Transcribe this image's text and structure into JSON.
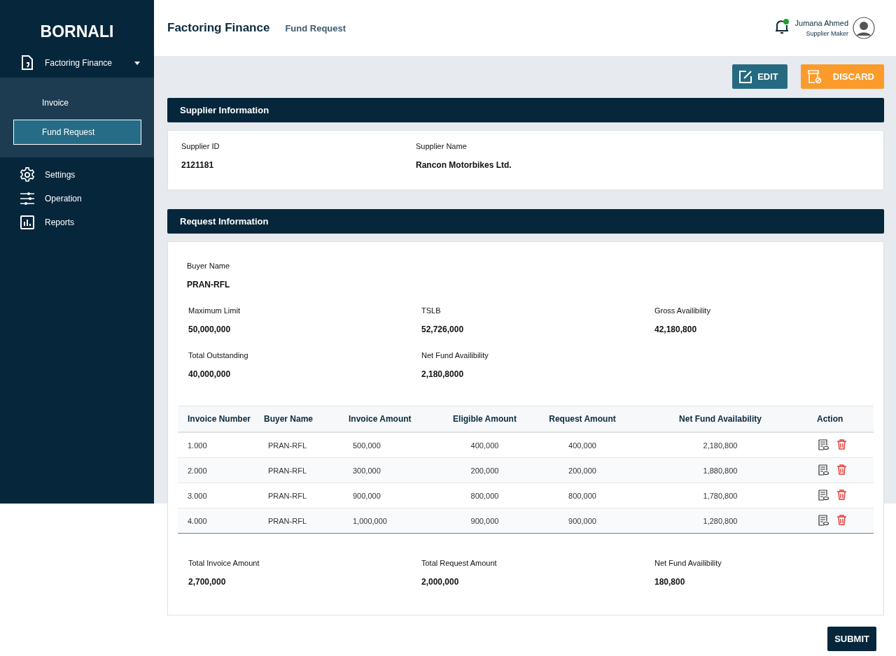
{
  "sidebar": {
    "brand": "BORNALI",
    "items": [
      {
        "label": "Factoring Finance",
        "expanded": true,
        "children": [
          {
            "label": "Invoice",
            "selected": false
          },
          {
            "label": "Fund Request",
            "selected": true
          }
        ]
      },
      {
        "label": "Settings"
      },
      {
        "label": "Operation"
      },
      {
        "label": "Reports"
      }
    ]
  },
  "header": {
    "title": "Factoring Finance",
    "subtitle": "Fund Request",
    "user": {
      "name": "Jumana Ahmed",
      "role": "Supplier Maker",
      "unread": true
    }
  },
  "actions": [
    {
      "label": "EDIT",
      "kind": "edit"
    },
    {
      "label": "DISCARD",
      "kind": "discard"
    }
  ],
  "supplier_information": {
    "title": "Supplier Information",
    "fields": [
      {
        "label": "Supplier ID",
        "value": "2121181"
      },
      {
        "label": "Supplier Name",
        "value": "Rancon Motorbikes Ltd."
      }
    ]
  },
  "request_information": {
    "title": "Request Information",
    "buyer": {
      "label": "Buyer Name",
      "value": "PRAN-RFL"
    },
    "fields": [
      {
        "label": "Maximum Limit",
        "value": "50,000,000"
      },
      {
        "label": "TSLB",
        "value": "52,726,000"
      },
      {
        "label": "Gross Availibility",
        "value": "42,180,800"
      },
      {
        "label": "Total Outstanding",
        "value": "40,000,000"
      },
      {
        "label": "Net Fund Availibility",
        "value": "2,180,8000"
      }
    ],
    "table": {
      "columns": [
        "Invoice Number",
        "Buyer Name",
        "Invoice Amount",
        "Eligible Amount",
        "Request Amount",
        "Net Fund Availability",
        "Action"
      ],
      "rows": [
        [
          "1.000",
          "PRAN-RFL",
          "500,000",
          "400,000",
          "400,000",
          "2,180,800"
        ],
        [
          "2.000",
          "PRAN-RFL",
          "300,000",
          "200,000",
          "200,000",
          "1,880,800"
        ],
        [
          "3.000",
          "PRAN-RFL",
          "900,000",
          "800,000",
          "800,000",
          "1,780,800"
        ],
        [
          "4.000",
          "PRAN-RFL",
          "1,000,000",
          "900,000",
          "900,000",
          "1,280,800"
        ]
      ]
    },
    "totals": [
      {
        "label": "Total Invoice Amount",
        "value": "2,700,000"
      },
      {
        "label": "Total Request Amount",
        "value": "2,000,000"
      },
      {
        "label": "Net Fund Availibility",
        "value": "180,800"
      }
    ]
  },
  "submit": "SUBMIT"
}
